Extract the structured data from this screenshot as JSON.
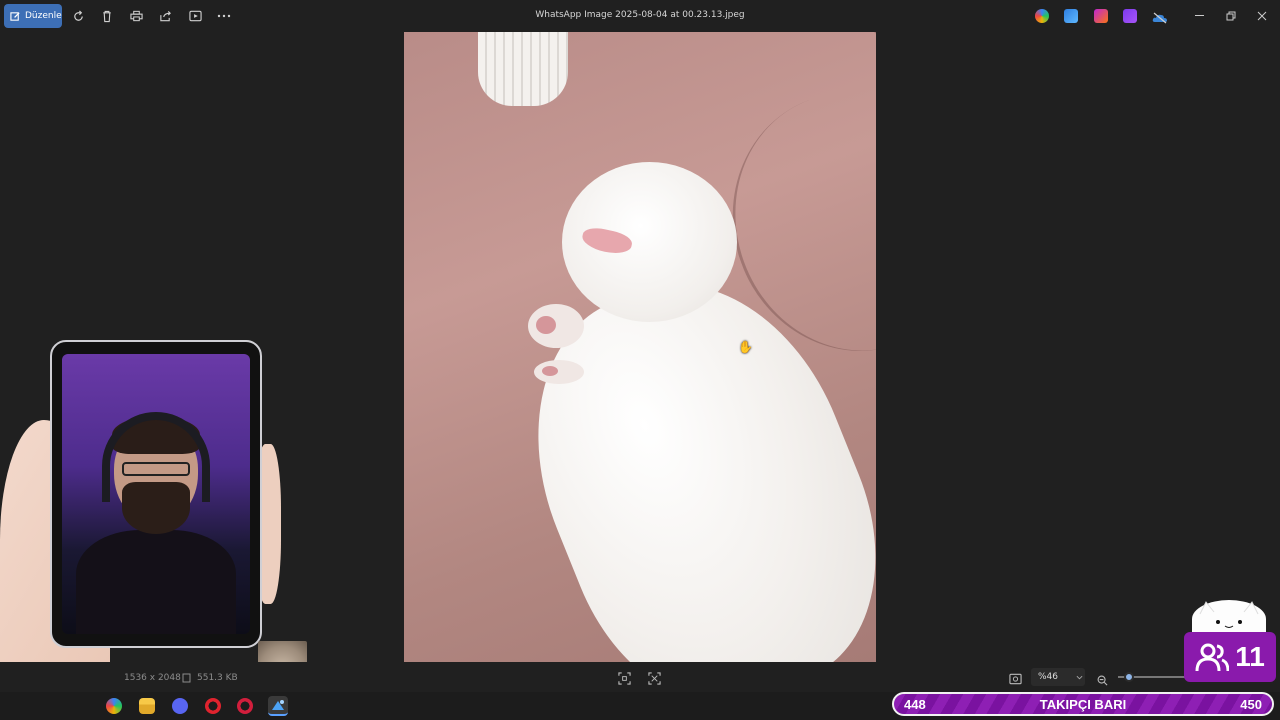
{
  "toolbar": {
    "edit_label": "Düzenle",
    "file_title": "WhatsApp Image 2025-08-04 at 00.23.13.jpeg"
  },
  "status": {
    "dimensions": "1536 x 2048",
    "file_size": "551.3 KB",
    "zoom": "%46"
  },
  "overlay": {
    "follower_current": "448",
    "follower_label": "TAKIPÇI BARI",
    "follower_goal": "450",
    "viewer_count": "11"
  },
  "colors": {
    "accent": "#3d6fb6",
    "overlay_purple": "#8a1aac"
  }
}
